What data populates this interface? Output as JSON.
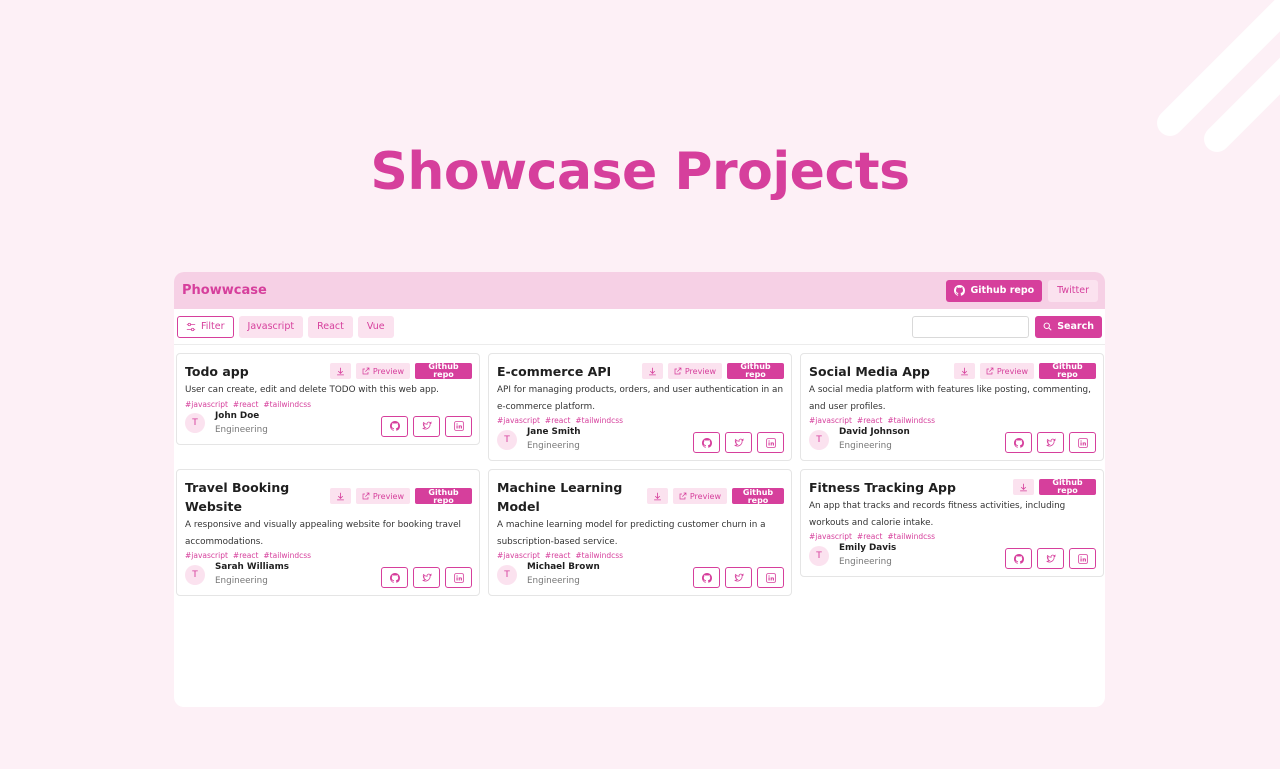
{
  "headline": "Showcase Projects",
  "app": {
    "brand": "Phowwcase",
    "github_label": "Github repo",
    "twitter_label": "Twitter"
  },
  "toolbar": {
    "filter_label": "Filter",
    "chips": [
      "Javascript",
      "React",
      "Vue"
    ],
    "search_value": "",
    "search_label": "Search"
  },
  "card_labels": {
    "preview": "Preview",
    "github": "Github repo"
  },
  "projects": [
    {
      "title": "Todo app",
      "description": "User can create, edit and delete TODO with this web app.",
      "tags": [
        "#javascript",
        "#react",
        "#tailwindcss"
      ],
      "author": "John Doe",
      "role": "Engineering",
      "initial": "T"
    },
    {
      "title": "E-commerce API",
      "description": "API for managing products, orders, and user authentication in an e-commerce platform.",
      "tags": [
        "#javascript",
        "#react",
        "#tailwindcss"
      ],
      "author": "Jane Smith",
      "role": "Engineering",
      "initial": "T"
    },
    {
      "title": "Social Media App",
      "description": "A social media platform with features like posting, commenting, and user profiles.",
      "tags": [
        "#javascript",
        "#react",
        "#tailwindcss"
      ],
      "author": "David Johnson",
      "role": "Engineering",
      "initial": "T"
    },
    {
      "title": "Travel Booking Website",
      "description": "A responsive and visually appealing website for booking travel accommodations.",
      "tags": [
        "#javascript",
        "#react",
        "#tailwindcss"
      ],
      "author": "Sarah Williams",
      "role": "Engineering",
      "initial": "T"
    },
    {
      "title": "Machine Learning Model",
      "description": "A machine learning model for predicting customer churn in a subscription-based service.",
      "tags": [
        "#javascript",
        "#react",
        "#tailwindcss"
      ],
      "author": "Michael Brown",
      "role": "Engineering",
      "initial": "T"
    },
    {
      "title": "Fitness Tracking App",
      "description": "An app that tracks and records fitness activities, including workouts and calorie intake.",
      "tags": [
        "#javascript",
        "#react",
        "#tailwindcss"
      ],
      "author": "Emily Davis",
      "role": "Engineering",
      "initial": "T"
    }
  ],
  "colors": {
    "accent": "#d63f9c",
    "accent_soft": "#fbe2ef",
    "topbar": "#f6d0e5",
    "background": "#fdf0f6"
  },
  "icons": [
    "github-icon",
    "sliders-icon",
    "search-icon",
    "download-icon",
    "external-link-icon",
    "twitter-icon",
    "linkedin-icon"
  ]
}
